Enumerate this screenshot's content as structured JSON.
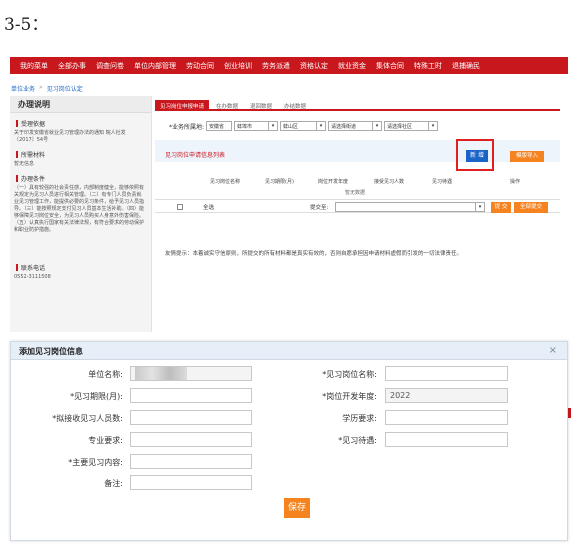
{
  "doc": {
    "caption": "3-5："
  },
  "nav": {
    "items": [
      "我的菜单",
      "全部办事",
      "调查问卷",
      "单位内部管理",
      "劳动合同",
      "创业培训",
      "劳务派遣",
      "资格认定",
      "就业资金",
      "集体合同",
      "特殊工时",
      "退捕确民"
    ]
  },
  "breadcrumb": {
    "home": "单位业务",
    "sep": "»",
    "current": "见习岗位认定"
  },
  "sidebar": {
    "title": "办理说明",
    "sections": [
      {
        "heading": "受理依据",
        "text": "关于印发安徽省就业见习管理办法的通知 皖人社发〔2017〕54号"
      },
      {
        "heading": "所需材料",
        "text": "暂无信息"
      },
      {
        "heading": "办理条件",
        "text": "（一）具有较强的社会责任感，内部制度健全，能够依照有关规定为见习人员进行相关管理。（二）有专门人员负责就业见习管理工作，能提供必要的见习条件，给予见习人员指导。（三）能按照规定支付见习人员基本生活补助。（四）能够保障见习岗位安全，为见习人员购买人身意外伤害保险。（五）认真执行国家有关法律法规，有符合要求的劳动保护和职业防护措施。"
      },
      {
        "heading": "联系电话",
        "text": "0552-3111508"
      }
    ]
  },
  "tabs": [
    {
      "label": "见习岗位申报申请"
    },
    {
      "label": "在办数据"
    },
    {
      "label": "退回数据"
    },
    {
      "label": "办结数据"
    }
  ],
  "filter": {
    "label": "*业务所属地:",
    "province": "安徽省",
    "city": "蚌埠市",
    "district": "蚌山区",
    "street": "请选择街道",
    "community": "请选择社区"
  },
  "panel": {
    "title": "见习岗位申请信息列表",
    "add_button": "新 增",
    "import_button": "模版导入"
  },
  "table": {
    "columns": [
      "见习岗位名称",
      "见习期限(月)",
      "岗位开发年度",
      "接受见习人数",
      "见习待遇",
      "操作"
    ],
    "empty_text": "暂无数据",
    "select_all_label": "全选",
    "submit_to_label": "提交至:",
    "submit_button": "提 交",
    "submit_all_button": "全部提交"
  },
  "tip": "友情提示：本着诚实守信原则，所提交的所有材料都是真实有效的，否则自愿承担因申请材料虚假而引发的一切法律责任。",
  "modal": {
    "title": "添加见习岗位信息",
    "close": "×",
    "fields": {
      "unit_name_label": "单位名称:",
      "post_name_label": "*见习岗位名称:",
      "period_label": "*见习期限(月):",
      "year_label": "*岗位开发年度:",
      "year_value": "2022",
      "people_label": "*拟接收见习人员数:",
      "edu_label": "学历要求:",
      "major_label": "专业要求:",
      "treatment_label": "*见习待遇:",
      "content_label": "*主要见习内容:",
      "remark_label": "备注:"
    },
    "save_button": "保存"
  },
  "colors": {
    "brand_red": "#c8171d",
    "accent_blue": "#1a64c8",
    "orange": "#f5831f"
  }
}
